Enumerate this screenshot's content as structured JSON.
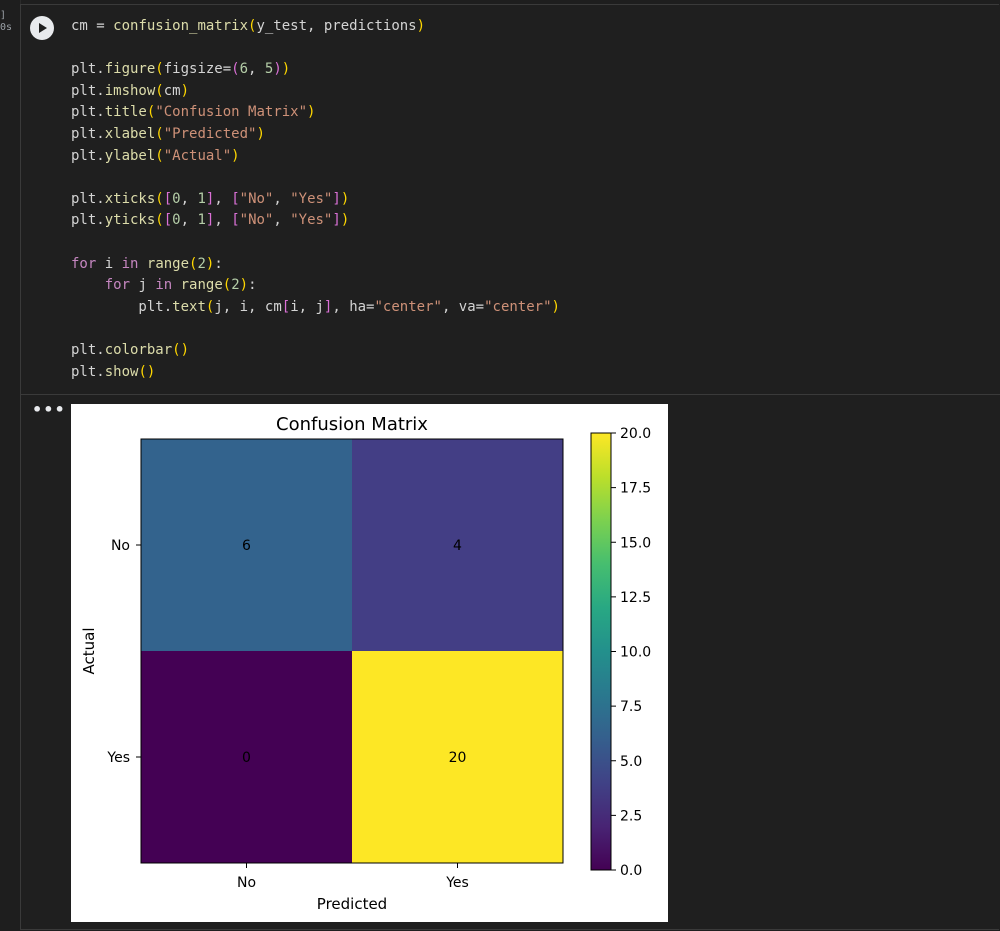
{
  "cell": {
    "exec_count": "]",
    "exec_time": "0s",
    "run_label": "Run cell",
    "output_menu": "•••"
  },
  "code_lines": [
    [
      [
        "c-var",
        "cm = "
      ],
      [
        "c-fn",
        "confusion_matrix"
      ],
      [
        "c-p1",
        "("
      ],
      [
        "c-var",
        "y_test, predictions"
      ],
      [
        "c-p1",
        ")"
      ]
    ],
    [],
    [
      [
        "c-var",
        "plt."
      ],
      [
        "c-fn",
        "figure"
      ],
      [
        "c-p1",
        "("
      ],
      [
        "c-var",
        "figsize="
      ],
      [
        "c-p2",
        "("
      ],
      [
        "c-num",
        "6"
      ],
      [
        "c-var",
        ", "
      ],
      [
        "c-num",
        "5"
      ],
      [
        "c-p2",
        ")"
      ],
      [
        "c-p1",
        ")"
      ]
    ],
    [
      [
        "c-var",
        "plt."
      ],
      [
        "c-fn",
        "imshow"
      ],
      [
        "c-p1",
        "("
      ],
      [
        "c-var",
        "cm"
      ],
      [
        "c-p1",
        ")"
      ]
    ],
    [
      [
        "c-var",
        "plt."
      ],
      [
        "c-fn",
        "title"
      ],
      [
        "c-p1",
        "("
      ],
      [
        "c-str",
        "\"Confusion Matrix\""
      ],
      [
        "c-p1",
        ")"
      ]
    ],
    [
      [
        "c-var",
        "plt."
      ],
      [
        "c-fn",
        "xlabel"
      ],
      [
        "c-p1",
        "("
      ],
      [
        "c-str",
        "\"Predicted\""
      ],
      [
        "c-p1",
        ")"
      ]
    ],
    [
      [
        "c-var",
        "plt."
      ],
      [
        "c-fn",
        "ylabel"
      ],
      [
        "c-p1",
        "("
      ],
      [
        "c-str",
        "\"Actual\""
      ],
      [
        "c-p1",
        ")"
      ]
    ],
    [],
    [
      [
        "c-var",
        "plt."
      ],
      [
        "c-fn",
        "xticks"
      ],
      [
        "c-p1",
        "("
      ],
      [
        "c-p2",
        "["
      ],
      [
        "c-num",
        "0"
      ],
      [
        "c-var",
        ", "
      ],
      [
        "c-num",
        "1"
      ],
      [
        "c-p2",
        "]"
      ],
      [
        "c-var",
        ", "
      ],
      [
        "c-p2",
        "["
      ],
      [
        "c-str",
        "\"No\""
      ],
      [
        "c-var",
        ", "
      ],
      [
        "c-str",
        "\"Yes\""
      ],
      [
        "c-p2",
        "]"
      ],
      [
        "c-p1",
        ")"
      ]
    ],
    [
      [
        "c-var",
        "plt."
      ],
      [
        "c-fn",
        "yticks"
      ],
      [
        "c-p1",
        "("
      ],
      [
        "c-p2",
        "["
      ],
      [
        "c-num",
        "0"
      ],
      [
        "c-var",
        ", "
      ],
      [
        "c-num",
        "1"
      ],
      [
        "c-p2",
        "]"
      ],
      [
        "c-var",
        ", "
      ],
      [
        "c-p2",
        "["
      ],
      [
        "c-str",
        "\"No\""
      ],
      [
        "c-var",
        ", "
      ],
      [
        "c-str",
        "\"Yes\""
      ],
      [
        "c-p2",
        "]"
      ],
      [
        "c-p1",
        ")"
      ]
    ],
    [],
    [
      [
        "c-kw",
        "for"
      ],
      [
        "c-var",
        " i "
      ],
      [
        "c-kw",
        "in"
      ],
      [
        "c-var",
        " "
      ],
      [
        "c-fn",
        "range"
      ],
      [
        "c-p1",
        "("
      ],
      [
        "c-num",
        "2"
      ],
      [
        "c-p1",
        ")"
      ],
      [
        "c-var",
        ":"
      ]
    ],
    [
      [
        "c-var",
        "    "
      ],
      [
        "c-kw",
        "for"
      ],
      [
        "c-var",
        " j "
      ],
      [
        "c-kw",
        "in"
      ],
      [
        "c-var",
        " "
      ],
      [
        "c-fn",
        "range"
      ],
      [
        "c-p1",
        "("
      ],
      [
        "c-num",
        "2"
      ],
      [
        "c-p1",
        ")"
      ],
      [
        "c-var",
        ":"
      ]
    ],
    [
      [
        "c-var",
        "        plt."
      ],
      [
        "c-fn",
        "text"
      ],
      [
        "c-p1",
        "("
      ],
      [
        "c-var",
        "j, i, cm"
      ],
      [
        "c-p2",
        "["
      ],
      [
        "c-var",
        "i, j"
      ],
      [
        "c-p2",
        "]"
      ],
      [
        "c-var",
        ", ha="
      ],
      [
        "c-str",
        "\"center\""
      ],
      [
        "c-var",
        ", va="
      ],
      [
        "c-str",
        "\"center\""
      ],
      [
        "c-p1",
        ")"
      ]
    ],
    [],
    [
      [
        "c-var",
        "plt."
      ],
      [
        "c-fn",
        "colorbar"
      ],
      [
        "c-p1",
        "()"
      ]
    ],
    [
      [
        "c-var",
        "plt."
      ],
      [
        "c-fn",
        "show"
      ],
      [
        "c-p1",
        "()"
      ]
    ]
  ],
  "chart_data": {
    "type": "heatmap",
    "title": "Confusion Matrix",
    "xlabel": "Predicted",
    "ylabel": "Actual",
    "x_categories": [
      "No",
      "Yes"
    ],
    "y_categories": [
      "No",
      "Yes"
    ],
    "values": [
      [
        6,
        4
      ],
      [
        0,
        20
      ]
    ],
    "colormap": "viridis",
    "vmin": 0,
    "vmax": 20,
    "colorbar_ticks": [
      "0.0",
      "2.5",
      "5.0",
      "7.5",
      "10.0",
      "12.5",
      "15.0",
      "17.5",
      "20.0"
    ],
    "colors": {
      "6": "#33638d",
      "4": "#433e85",
      "0": "#440154",
      "20": "#fde725"
    }
  }
}
